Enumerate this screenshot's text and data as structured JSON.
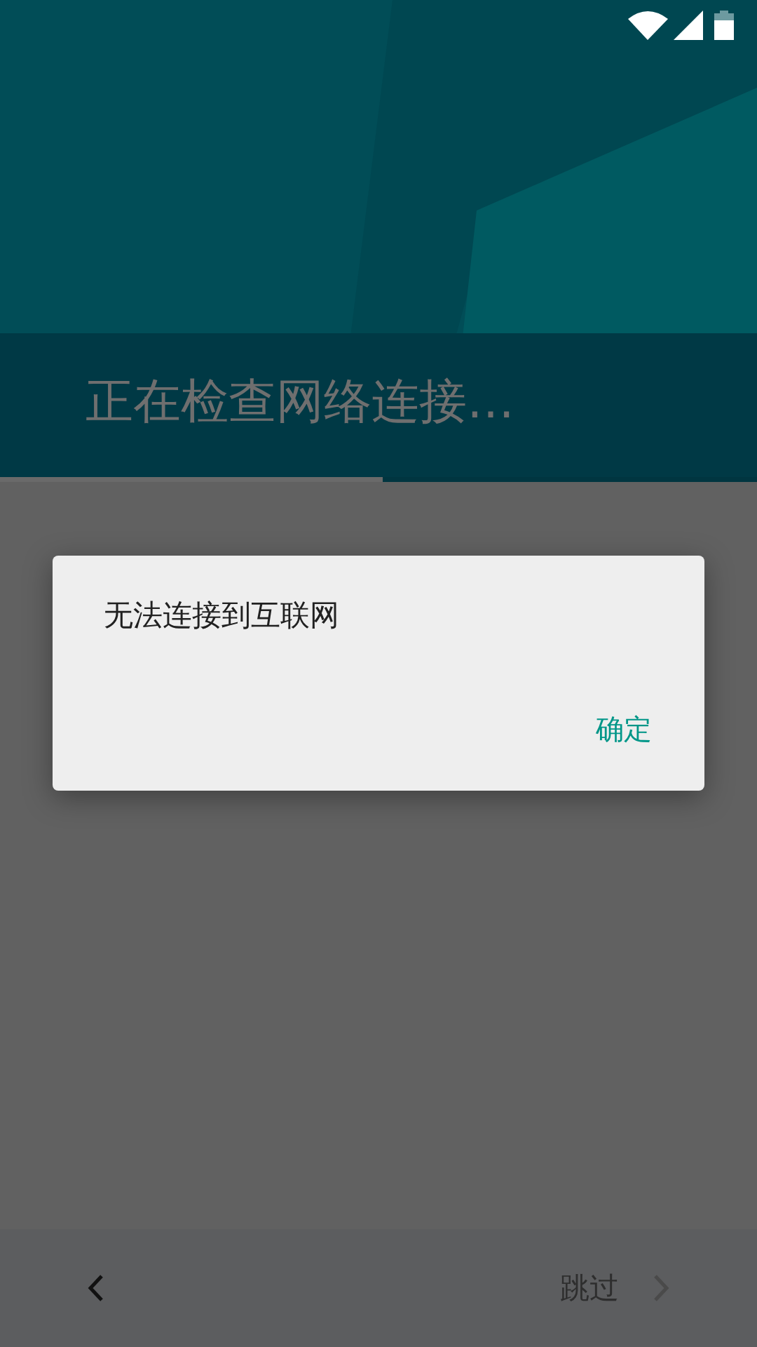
{
  "header": {
    "title": "正在检查网络连接…"
  },
  "progress": {
    "level": 0.506
  },
  "dialog": {
    "message": "无法连接到互联网",
    "buttons": [
      {
        "label": "确定"
      }
    ]
  },
  "bottom_bar": {
    "skip": {
      "label": "跳过"
    }
  }
}
